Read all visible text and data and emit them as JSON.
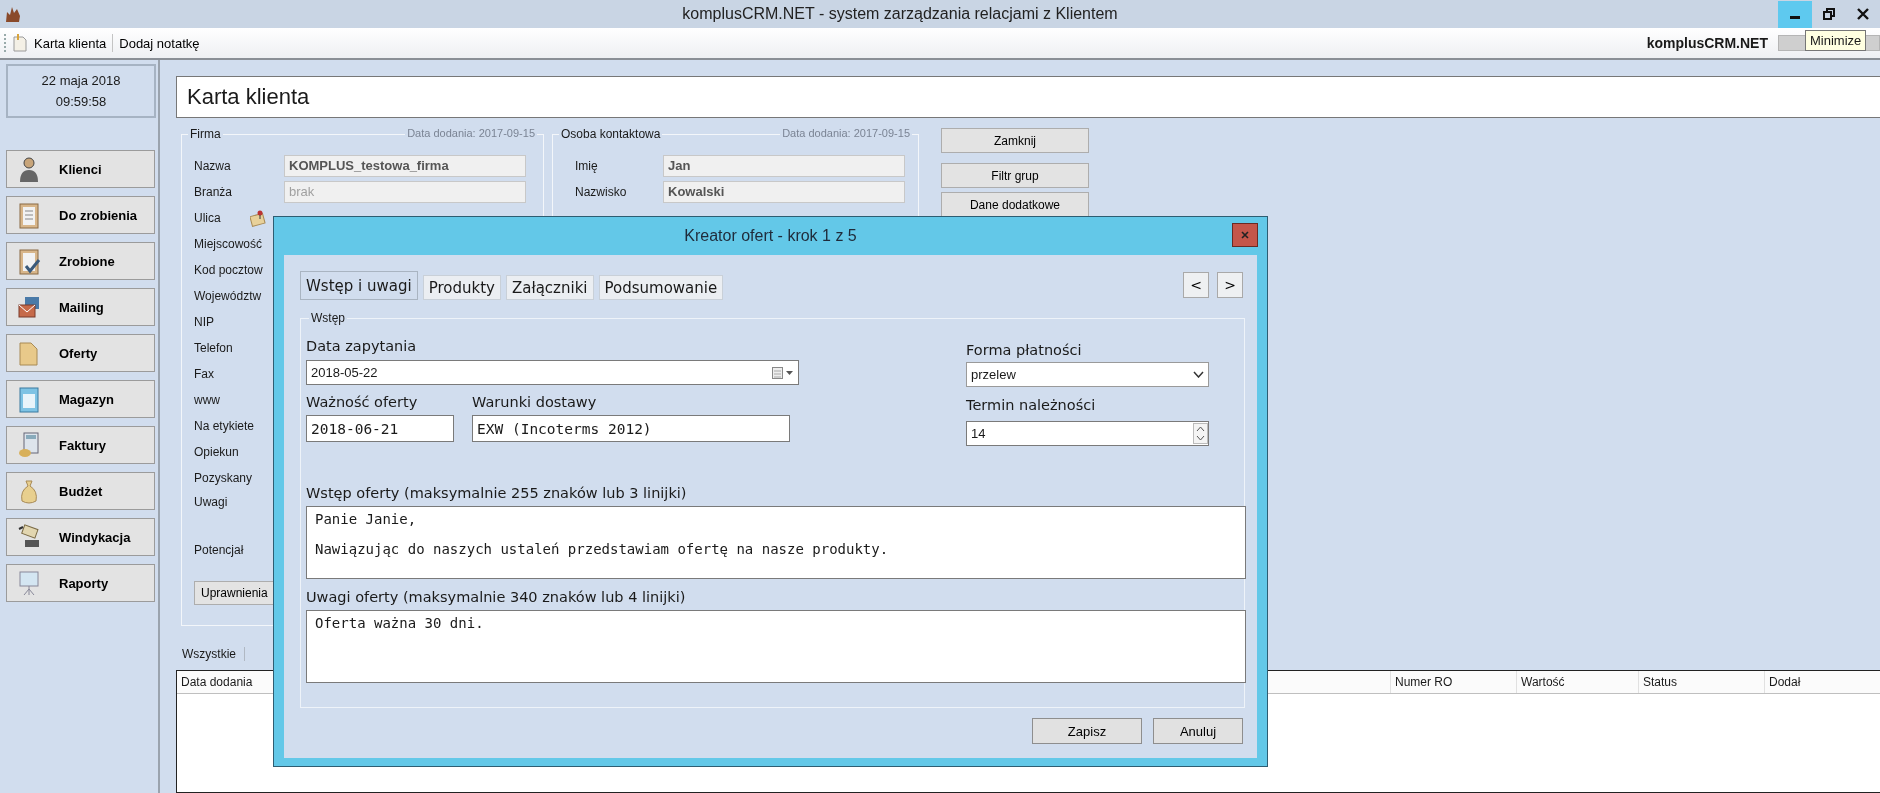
{
  "window": {
    "title": "komplusCRM.NET - system zarządzania relacjami z Klientem",
    "controls": [
      {
        "kind": "minimize",
        "hovered": true
      },
      {
        "kind": "restore",
        "hovered": false
      },
      {
        "kind": "close",
        "hovered": false
      }
    ],
    "tooltip": "Minimize"
  },
  "toolbar": {
    "items": [
      "Karta klienta",
      "Dodaj notatkę"
    ],
    "brand": "komplusCRM.NET"
  },
  "sidebar": {
    "date": "22 maja 2018",
    "time": "09:59:58",
    "items": [
      "Klienci",
      "Do zrobienia",
      "Zrobione",
      "Mailing",
      "Oferty",
      "Magazyn",
      "Faktury",
      "Budżet",
      "Windykacja",
      "Raporty"
    ]
  },
  "page": {
    "title": "Karta klienta",
    "company": {
      "legend": "Firma",
      "added": "Data dodania: 2017-09-15",
      "rows": [
        {
          "kind": "field",
          "label": "Nazwa",
          "value": "KOMPLUS_testowa_firma"
        },
        {
          "kind": "field",
          "label": "Branża",
          "placeholder": "brak"
        },
        {
          "kind": "pinned",
          "label": "Ulica"
        },
        {
          "kind": "plain",
          "label": "Miejscowość"
        },
        {
          "kind": "plain",
          "label": "Kod pocztow"
        },
        {
          "kind": "plain",
          "label": "Województw"
        },
        {
          "kind": "plain",
          "label": "NIP"
        },
        {
          "kind": "plain",
          "label": "Telefon"
        },
        {
          "kind": "plain",
          "label": "Fax"
        },
        {
          "kind": "plain",
          "label": "www"
        },
        {
          "kind": "plain",
          "label": "Na etykiete"
        },
        {
          "kind": "plain",
          "label": "Opiekun"
        },
        {
          "kind": "plain",
          "label": "Pozyskany"
        },
        {
          "kind": "tall",
          "label": "Uwagi"
        },
        {
          "kind": "plain",
          "label": "Potencjał"
        }
      ],
      "button": "Uprawnienia"
    },
    "contact": {
      "legend": "Osoba kontaktowa",
      "added": "Data dodania: 2017-09-15",
      "rows": [
        {
          "kind": "field",
          "label": "Imię",
          "value": "Jan"
        },
        {
          "kind": "field",
          "label": "Nazwisko",
          "value": "Kowalski"
        }
      ]
    },
    "buttons": [
      "Zamknij",
      "Filtr grup",
      "Dane dodatkowe"
    ],
    "list": {
      "tabs": [
        "Wszystkie"
      ],
      "columns": [
        "Data dodania",
        "Numer RO",
        "Wartość",
        "Status",
        "Dodał"
      ]
    }
  },
  "dialog": {
    "title": "Kreator ofert - krok 1 z 5",
    "tabs": [
      {
        "label": "Wstęp i uwagi",
        "selected": true
      },
      {
        "label": "Produkty",
        "selected": false
      },
      {
        "label": "Załączniki",
        "selected": false
      },
      {
        "label": "Podsumowanie",
        "selected": false
      }
    ],
    "nav": [
      "<",
      ">"
    ],
    "group": "Wstęp",
    "inquiry_date": {
      "label": "Data zapytania",
      "value": "2018-05-22"
    },
    "validity": {
      "label": "Ważność oferty",
      "value": "2018-06-21"
    },
    "delivery": {
      "label": "Warunki dostawy",
      "value": "EXW (Incoterms 2012)"
    },
    "payment": {
      "label": "Forma płatności",
      "value": "przelew"
    },
    "due": {
      "label": "Termin należności",
      "value": "14"
    },
    "intro": {
      "label": "Wstęp oferty (maksymalnie 255 znaków lub 3 linijki)",
      "value": "Panie Janie,\n\nNawiązując do naszych ustaleń przedstawiam ofertę na nasze produkty."
    },
    "notes": {
      "label": "Uwagi oferty (maksymalnie 340 znaków lub 4 linijki)",
      "value": "Oferta ważna 30 dni."
    },
    "buttons": [
      "Zapisz",
      "Anuluj"
    ]
  }
}
